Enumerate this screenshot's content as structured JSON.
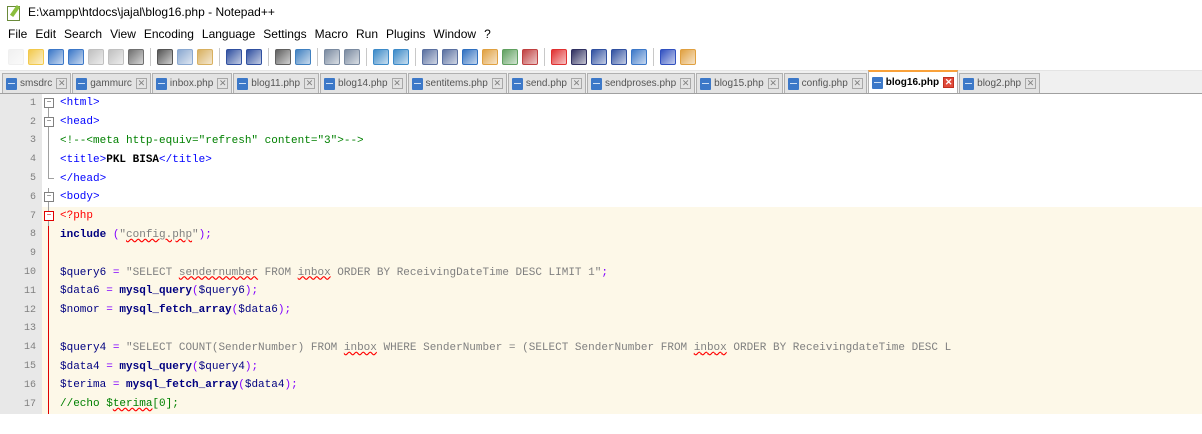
{
  "window": {
    "title": "E:\\xampp\\htdocs\\jajal\\blog16.php - Notepad++"
  },
  "menu": [
    "File",
    "Edit",
    "Search",
    "View",
    "Encoding",
    "Language",
    "Settings",
    "Macro",
    "Run",
    "Plugins",
    "Window",
    "?"
  ],
  "toolbar": {
    "buttons": [
      "new-file-icon",
      "open-file-icon",
      "save-icon",
      "save-all-icon",
      "close-icon",
      "close-all-icon",
      "print-icon",
      "sep",
      "cut-icon",
      "copy-icon",
      "paste-icon",
      "sep",
      "undo-icon",
      "redo-icon",
      "sep",
      "find-icon",
      "replace-icon",
      "sep",
      "zoom-in-icon",
      "zoom-out-icon",
      "sep",
      "sync-v-icon",
      "sync-h-icon",
      "sep",
      "word-wrap-icon",
      "all-chars-icon",
      "indent-guide-icon",
      "lang-icon",
      "doc-map-icon",
      "func-list-icon",
      "sep",
      "record-macro-icon",
      "stop-macro-icon",
      "play-macro-icon",
      "run-macro-multi-icon",
      "save-macro-icon",
      "sep",
      "spellcheck-icon",
      "paint-icon"
    ]
  },
  "tabs": [
    {
      "label": "smsdrc",
      "active": false
    },
    {
      "label": "gammurc",
      "active": false
    },
    {
      "label": "inbox.php",
      "active": false
    },
    {
      "label": "blog11.php",
      "active": false
    },
    {
      "label": "blog14.php",
      "active": false
    },
    {
      "label": "sentitems.php",
      "active": false
    },
    {
      "label": "send.php",
      "active": false
    },
    {
      "label": "sendproses.php",
      "active": false
    },
    {
      "label": "blog15.php",
      "active": false
    },
    {
      "label": "config.php",
      "active": false
    },
    {
      "label": "blog16.php",
      "active": true
    },
    {
      "label": "blog2.php",
      "active": false
    }
  ],
  "tab_close_glyph": "✕",
  "editor": {
    "line_numbers": [
      "1",
      "2",
      "3",
      "4",
      "5",
      "6",
      "7",
      "8",
      "9",
      "10",
      "11",
      "12",
      "13",
      "14",
      "15",
      "16",
      "17"
    ],
    "lines": [
      {
        "t": [
          "<html>"
        ]
      },
      {
        "t": [
          "<head>"
        ]
      },
      {
        "t": [
          "<!--<meta http-equiv=\"refresh\" content=\"3\">-->"
        ]
      },
      {
        "t": [
          "<title>",
          "PKL BISA",
          "</title>"
        ]
      },
      {
        "t": [
          "</head>"
        ]
      },
      {
        "t": [
          "<body>"
        ]
      },
      {
        "t": [
          "<?php"
        ]
      },
      {
        "t": [
          "include",
          " (",
          "\"",
          "config.php",
          "\"",
          ");"
        ]
      },
      {
        "t": [
          ""
        ]
      },
      {
        "t": [
          "$query6",
          " = ",
          "\"SELECT ",
          "sendernumber",
          " FROM ",
          "inbox",
          " ORDER BY ReceivingDateTime DESC LIMIT 1\"",
          ";"
        ]
      },
      {
        "t": [
          "$data6",
          " = ",
          "mysql_query",
          "(",
          "$query6",
          ");"
        ]
      },
      {
        "t": [
          "$nomor",
          " = ",
          "mysql_fetch_array",
          "(",
          "$data6",
          ");"
        ]
      },
      {
        "t": [
          ""
        ]
      },
      {
        "t": [
          "$query4",
          " = ",
          "\"SELECT COUNT(SenderNumber) FROM ",
          "inbox",
          " WHERE SenderNumber = (SELECT SenderNumber FROM ",
          "inbox",
          " ORDER BY ReceivingdateTime DESC L"
        ]
      },
      {
        "t": [
          "$data4",
          " = ",
          "mysql_query",
          "(",
          "$query4",
          ");"
        ]
      },
      {
        "t": [
          "$terima",
          " = ",
          "mysql_fetch_array",
          "(",
          "$data4",
          ");"
        ]
      },
      {
        "t": [
          "//echo $",
          "terima",
          "[0];"
        ]
      }
    ]
  }
}
